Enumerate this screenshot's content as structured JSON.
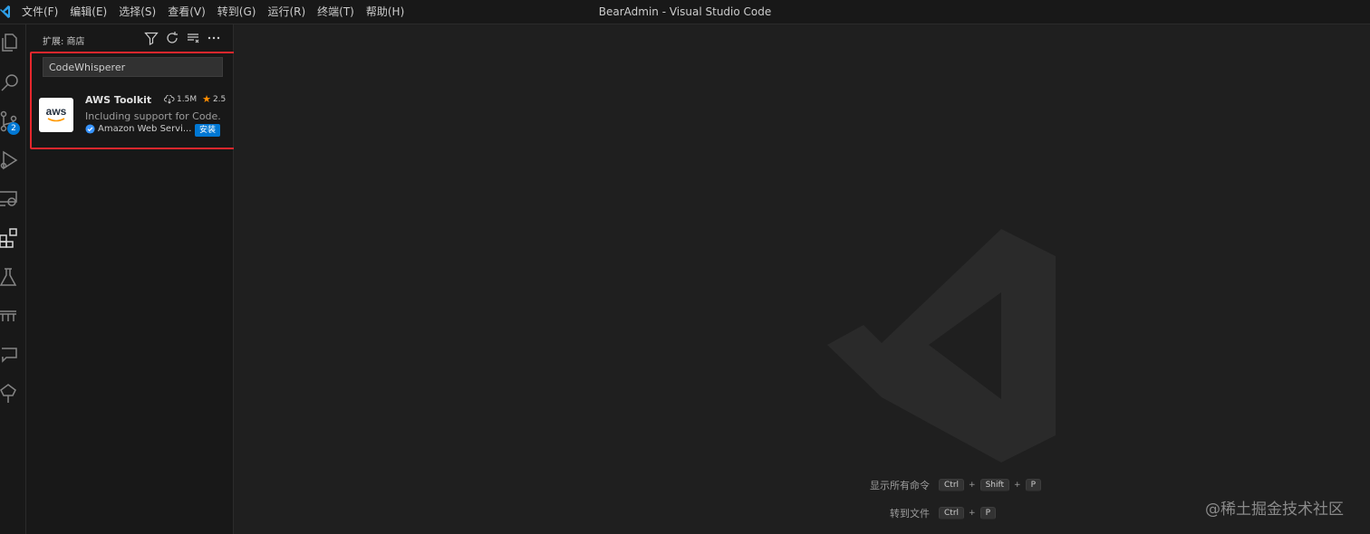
{
  "titlebar": {
    "menu": [
      "文件(F)",
      "编辑(E)",
      "选择(S)",
      "查看(V)",
      "转到(G)",
      "运行(R)",
      "终端(T)",
      "帮助(H)"
    ],
    "window_title": "BearAdmin - Visual Studio Code"
  },
  "activitybar": {
    "icons": [
      "explorer-icon",
      "search-icon",
      "source-control-icon",
      "run-debug-icon",
      "remote-explorer-icon",
      "extensions-icon",
      "testing-icon",
      "remote-bridge-icon",
      "chat-icon",
      "tree-icon"
    ],
    "source_control_badge": "2"
  },
  "sidebar": {
    "title": "扩展: 商店",
    "search_value": "CodeWhisperer",
    "extension": {
      "name": "AWS Toolkit",
      "logo_text": "aws",
      "downloads": "1.5M",
      "rating": "2.5",
      "description": "Including support for Code...",
      "publisher": "Amazon Web Servi...",
      "install_label": "安装"
    }
  },
  "editor": {
    "shortcuts": [
      {
        "label": "显示所有命令",
        "keys": [
          "Ctrl",
          "Shift",
          "P"
        ]
      },
      {
        "label": "转到文件",
        "keys": [
          "Ctrl",
          "P"
        ]
      }
    ]
  },
  "watermark": "@稀土掘金技术社区",
  "colors": {
    "accent": "#0078d4",
    "highlight_box": "#e5272d",
    "star": "#ff8e00"
  }
}
